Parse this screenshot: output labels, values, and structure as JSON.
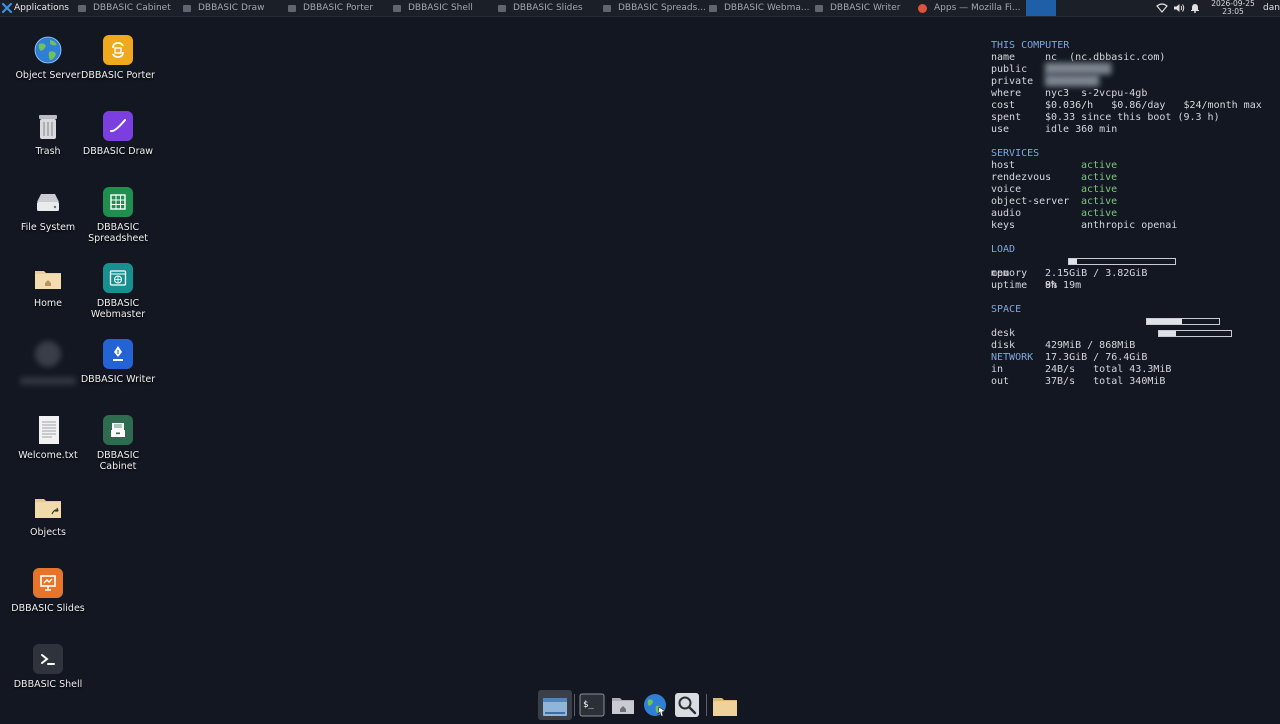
{
  "topbar": {
    "applications_label": "Applications",
    "tasks": [
      {
        "label": "DBBASIC Cabinet",
        "icon": "window-icon"
      },
      {
        "label": "DBBASIC Draw",
        "icon": "window-icon"
      },
      {
        "label": "DBBASIC Porter",
        "icon": "window-icon"
      },
      {
        "label": "DBBASIC Shell",
        "icon": "window-icon"
      },
      {
        "label": "DBBASIC Slides",
        "icon": "window-icon"
      },
      {
        "label": "DBBASIC Spreads...",
        "icon": "window-icon"
      },
      {
        "label": "DBBASIC Webma...",
        "icon": "window-icon"
      },
      {
        "label": "DBBASIC Writer",
        "icon": "window-icon"
      },
      {
        "label": "Apps — Mozilla Fi...",
        "icon": "firefox-icon"
      }
    ],
    "clock_date": "2026-09-25",
    "clock_time": "23:05",
    "user": "dan"
  },
  "desktop": {
    "icons": [
      {
        "label": "Object Server",
        "icon": "globe-icon"
      },
      {
        "label": "DBBASIC Porter",
        "icon": "porter-app-icon"
      },
      {
        "label": "Trash",
        "icon": "trash-icon"
      },
      {
        "label": "DBBASIC Draw",
        "icon": "draw-app-icon"
      },
      {
        "label": "File System",
        "icon": "drive-icon"
      },
      {
        "label": "DBBASIC Spreadsheet",
        "icon": "spreadsheet-app-icon"
      },
      {
        "label": "Home",
        "icon": "home-folder-icon"
      },
      {
        "label": "DBBASIC Webmaster",
        "icon": "webmaster-app-icon"
      },
      {
        "label": "DBBASIC Writer",
        "icon": "writer-app-icon"
      },
      {
        "label": "Welcome.txt",
        "icon": "text-file-icon"
      },
      {
        "label": "DBBASIC Cabinet",
        "icon": "cabinet-app-icon"
      },
      {
        "label": "Objects",
        "icon": "folder-link-icon"
      },
      {
        "label": "DBBASIC Slides",
        "icon": "slides-app-icon"
      },
      {
        "label": "DBBASIC Shell",
        "icon": "shell-app-icon"
      }
    ]
  },
  "conky": {
    "this_computer": {
      "header": "THIS COMPUTER",
      "name_key": "name",
      "name_val": "nc  (nc.dbbasic.com)",
      "public_key": "public",
      "private_key": "private",
      "where_key": "where",
      "where_val": "nyc3  s-2vcpu-4gb",
      "cost_key": "cost",
      "cost_val": "$0.036/h   $0.86/day   $24/month max",
      "spent_key": "spent",
      "spent_val": "$0.33 since this boot (9.3 h)",
      "use_key": "use",
      "use_val": "idle 360 min"
    },
    "services": {
      "header": "SERVICES",
      "rows": [
        {
          "key": "host",
          "val": "active"
        },
        {
          "key": "rendezvous",
          "val": "active"
        },
        {
          "key": "voice",
          "val": "active"
        },
        {
          "key": "object-server",
          "val": "active"
        },
        {
          "key": "audio",
          "val": "active"
        },
        {
          "key": "keys",
          "val": "anthropic openai"
        }
      ]
    },
    "load": {
      "header": "LOAD",
      "cpu_key": "cpu",
      "cpu_val": "8%",
      "cpu_fraction": 0.08,
      "memory_key": "memory",
      "memory_val": "2.15GiB / 3.82GiB",
      "uptime_key": "uptime",
      "uptime_val": "9h 19m"
    },
    "space": {
      "header": "SPACE",
      "desk_key": "desk",
      "desk_val": "429MiB / 868MiB",
      "desk_fraction": 0.49,
      "disk_key": "disk",
      "disk_val": "17.3GiB / 76.4GiB",
      "disk_fraction": 0.23
    },
    "network": {
      "header": "NETWORK",
      "in_key": "in",
      "in_val": "24B/s   total 43.3MiB",
      "out_key": "out",
      "out_val": "37B/s   total 340MiB"
    }
  },
  "dock": {
    "items": [
      {
        "icon": "window-list-icon"
      },
      {
        "icon": "terminal-icon"
      },
      {
        "icon": "home-folder-icon"
      },
      {
        "icon": "web-browser-icon"
      },
      {
        "icon": "search-icon"
      },
      {
        "icon": "file-manager-icon"
      }
    ]
  },
  "colors": {
    "background": "#121721",
    "section_header": "#7fa8e0",
    "active_status": "#7ec87a",
    "active_task_block": "#1f5fa8"
  }
}
